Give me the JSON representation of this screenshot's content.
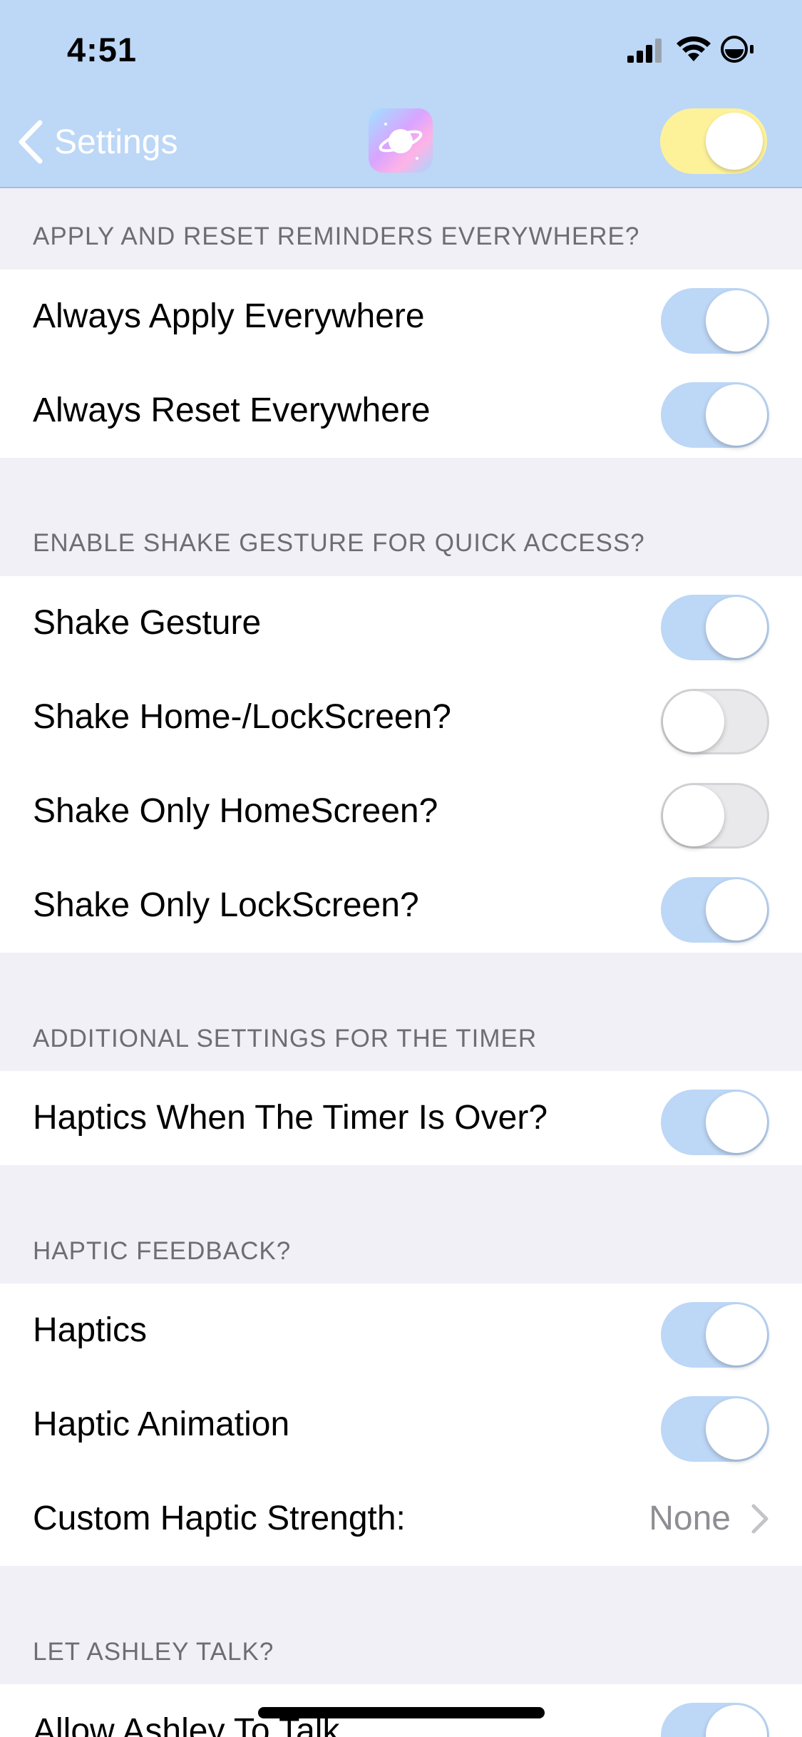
{
  "status_bar": {
    "time": "4:51"
  },
  "nav": {
    "back_label": "Settings"
  },
  "sections": [
    {
      "title": "APPLY AND RESET REMINDERS EVERYWHERE?",
      "rows": [
        {
          "label": "Always Apply Everywhere",
          "on": true
        },
        {
          "label": "Always Reset Everywhere",
          "on": true
        }
      ]
    },
    {
      "title": "ENABLE SHAKE GESTURE FOR QUICK ACCESS?",
      "rows": [
        {
          "label": "Shake Gesture",
          "on": true
        },
        {
          "label": "Shake Home-/LockScreen?",
          "on": false
        },
        {
          "label": "Shake Only HomeScreen?",
          "on": false
        },
        {
          "label": "Shake Only LockScreen?",
          "on": true
        }
      ]
    },
    {
      "title": "ADDITIONAL SETTINGS FOR THE TIMER",
      "rows": [
        {
          "label": "Haptics When The Timer Is Over?",
          "on": true
        }
      ]
    },
    {
      "title": "HAPTIC FEEDBACK?",
      "rows": [
        {
          "label": "Haptics",
          "on": true
        },
        {
          "label": "Haptic Animation",
          "on": true
        },
        {
          "label": "Custom Haptic Strength:",
          "value": "None"
        }
      ]
    },
    {
      "title": "LET ASHLEY TALK?",
      "rows": [
        {
          "label": "Allow Ashley To Talk",
          "on": true
        }
      ]
    }
  ],
  "colors": {
    "header_bg": "#bdd7f6",
    "switch_on": "#bdd7f6",
    "master_switch": "#fdf29a",
    "page_bg": "#f1f0f6"
  }
}
